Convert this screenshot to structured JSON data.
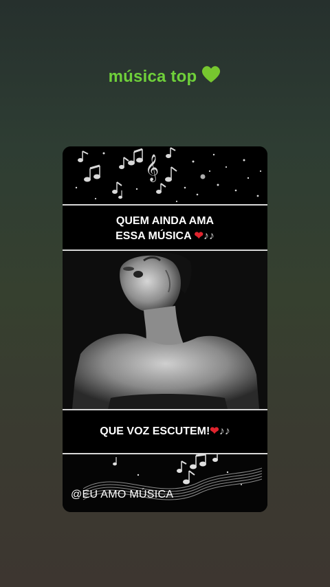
{
  "story": {
    "caption": "música top",
    "caption_emoji": "green-heart-icon",
    "caption_color": "#6fd03a"
  },
  "card": {
    "top_text_line1": "QUEM AINDA AMA",
    "top_text_line2": "ESSA MÚSICA",
    "bottom_text": "QUE VOZ ESCUTEM!",
    "watermark": "@EU AMO MÚSICA",
    "emoji_heart": "red-heart-icon",
    "emoji_notes": "music-notes-icon",
    "heart_color": "#e0242e"
  }
}
